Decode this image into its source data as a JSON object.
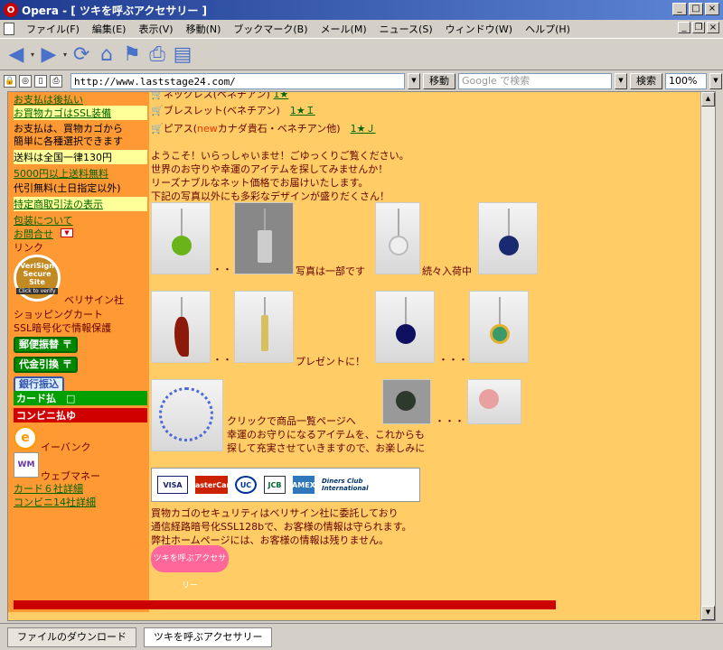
{
  "window": {
    "title": "Opera - [ ツキを呼ぶアクセサリー ]",
    "logo": "O"
  },
  "menu": [
    "ファイル(F)",
    "編集(E)",
    "表示(V)",
    "移動(N)",
    "ブックマーク(B)",
    "メール(M)",
    "ニュース(S)",
    "ウィンドウ(W)",
    "ヘルプ(H)"
  ],
  "toolbar": {
    "back": "◀",
    "forward": "▶",
    "dropdown": "▾",
    "reload": "⟳",
    "home": "⌂",
    "bookmark": "⚑",
    "print": "⎙",
    "page": "▤",
    "icon_lock": "🔒",
    "icon_camera": "◎",
    "icon_doc": "▯",
    "icon_printer": "⎙"
  },
  "address": {
    "url": "http://www.laststage24.com/",
    "go": "移動",
    "search_placeholder": "Google で検索",
    "search_btn": "検索",
    "zoom": "100%",
    "dropdown": "▼"
  },
  "sidebar": {
    "top_cut": "お支払は後払い",
    "cart_ssl": "お買物カゴはSSL装備",
    "pay_line1": "お支払は、買物カゴから",
    "pay_line2": "簡単に各種選択できます",
    "shipping_flat": "送料は全国一律130円",
    "free_shipping": "5000円以上送料無料",
    "cod_free": "代引無料(土日指定以外)",
    "law": "特定商取引法の表示",
    "wrapping": "包装について",
    "contact": "お問合せ",
    "links": "リンク",
    "verisign_label": "VeriSign Secure Site",
    "verisign_sub": "Click to verify",
    "verisign_text": "ベリサイン社",
    "cart_line1": "ショッピングカート",
    "cart_line2": "SSL暗号化で情報保護",
    "postal": "郵便振替",
    "cod": "代金引換",
    "bank": "銀行振込",
    "card_pay": "カード払",
    "conv_pay": "コンビニ払",
    "ebank": "イーバンク",
    "webmoney": "ウェブマネー",
    "card_detail": "カード６社詳細",
    "conv_detail": "コンビニ14社詳細",
    "postal_mark": "〒",
    "card_square": "□",
    "conv_mark": "ゆ",
    "ebank_mark": "e",
    "wm_mark": "WM"
  },
  "main": {
    "cat_top": "ネックレス(ペネチアン)",
    "cat_top_link": "1★",
    "bracelet": "ブレスレット(ベネチアン)",
    "bracelet_link": "1★Ｉ",
    "pierce_pre": "ピアス(",
    "pierce_new": "new",
    "pierce_post": "カナダ貴石・ベネチアン他)",
    "pierce_link": "1★Ｊ",
    "welcome1": "ようこそ！いらっしゃいませ！ごゆっくりご覧ください。",
    "welcome2": "世界のお守りや幸運のアイテムを探してみませんか！",
    "welcome3": "リーズナブルなネット価格でお届けいたします。",
    "welcome4": "下記の写真以外にも多彩なデザインが盛りだくさん！",
    "dots": "・・",
    "dots3": "・・・",
    "cart_icon": "🛒",
    "photo_note": "写真は一部です",
    "coming": "続々入荷中",
    "gift": "プレゼントに！",
    "click_list": "クリックで商品一覧ページへ",
    "growing1": "幸運のお守りになるアイテムを、これからも",
    "growing2": "探して充実させていきますので、お楽しみに",
    "security1": "買物カゴのセキュリティはベリサイン社に委託しており",
    "security2": "通信経路暗号化SSL128bで、お客様の情報は守られます。",
    "security3": "弊社ホームページには、お客様の情報は残りません。",
    "cards": [
      "VISA",
      "MasterCard",
      "UC",
      "JCB",
      "AMEX",
      "Diners Club International"
    ],
    "bottom_logo": "ツキを呼ぶアクセサリー"
  },
  "status": {
    "downloads": "ファイルのダウンロード",
    "tab": "ツキを呼ぶアクセサリー"
  }
}
